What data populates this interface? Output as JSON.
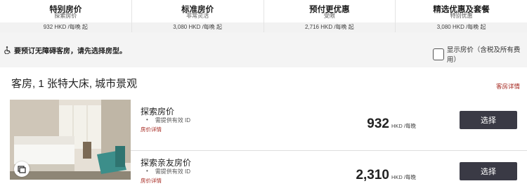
{
  "rate_tabs": [
    {
      "title": "特别房价",
      "subtitle": "探索房价",
      "price": "932 HKD /每晚 起"
    },
    {
      "title": "标准房价",
      "subtitle": "非常灵活",
      "price": "3,080 HKD /每晚 起"
    },
    {
      "title": "预付更优惠",
      "subtitle": "受限",
      "price": "2,716 HKD /每晚 起"
    },
    {
      "title": "精选优惠及套餐",
      "subtitle": "特别优惠",
      "price": "3,080 HKD /每晚 起"
    }
  ],
  "accessibility": {
    "text": "要预订无障碍客房，请先选择房型。",
    "icon": "wheelchair-icon"
  },
  "tax_toggle": {
    "label": "显示房价（含税及所有费用）",
    "checked": false
  },
  "room": {
    "title": "客房, 1 张特大床, 城市景观",
    "details_link": "客房详情",
    "gallery_icon": "gallery-icon",
    "rates": [
      {
        "name": "探索房价",
        "note_bullet": "•",
        "note": "需提供有效 ID",
        "details_link": "房价详情",
        "price": "932",
        "price_unit": "HKD /每晚",
        "button": "选择"
      },
      {
        "name": "探索亲友房价",
        "note_bullet": "•",
        "note": "需提供有效 ID",
        "details_link": "房价详情",
        "price": "2,310",
        "price_unit": "HKD /每晚",
        "button": "选择"
      }
    ]
  },
  "colors": {
    "accent_link": "#a4251d",
    "button_bg": "#3a3a45"
  }
}
